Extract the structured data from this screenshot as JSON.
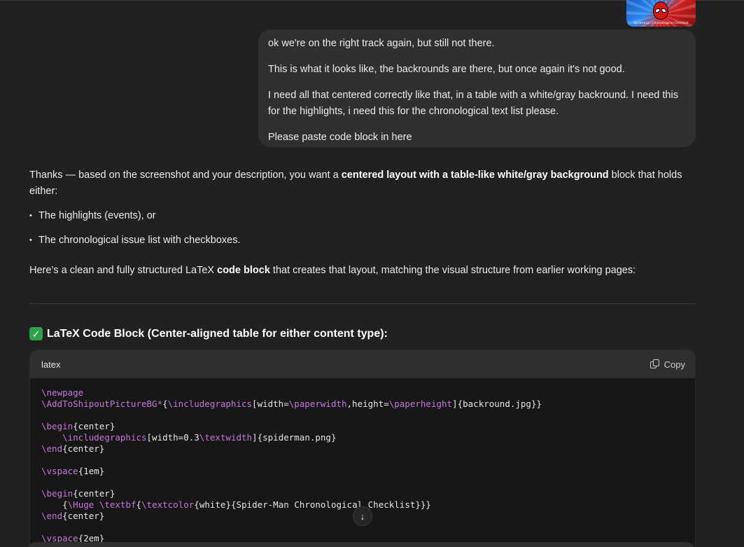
{
  "thumbnail": {
    "caption": "Spiderman Chronological Checklist"
  },
  "user_message": {
    "paragraphs": [
      "ok we're on the right track again, but still not there.",
      "This is what it looks like, the backrounds are there, but once again it's not good.",
      "I need all that centered correctly like that, in a table with a white/gray backround.  I need this for the highlights, i need this for the chronological text list please.",
      "Please paste code block in here"
    ]
  },
  "assistant": {
    "intro_before": "Thanks — based on the screenshot and your description, you want a ",
    "intro_bold": "centered layout with a table-like white/gray background",
    "intro_after": " block that holds either:",
    "bullets": [
      "The highlights (events), or",
      "The chronological issue list with checkboxes."
    ],
    "intro2_before": "Here’s a clean and fully structured LaTeX ",
    "intro2_bold": "code block",
    "intro2_after": " that creates that layout, matching the visual structure from earlier working pages:",
    "heading_icon": "✓",
    "heading": "LaTeX Code Block (Center-aligned table for either content type):"
  },
  "code_block": {
    "language": "latex",
    "copy_label": "Copy",
    "lines": [
      "\\newpage",
      "\\AddToShipoutPictureBG*{\\includegraphics[width=\\paperwidth,height=\\paperheight]{backround.jpg}}",
      "",
      "\\begin{center}",
      "    \\includegraphics[width=0.3\\textwidth]{spiderman.png}",
      "\\end{center}",
      "",
      "\\vspace{1em}",
      "",
      "\\begin{center}",
      "    {\\Huge \\textbf{\\textcolor{white}{Spider-Man Chronological Checklist}}}",
      "\\end{center}",
      "",
      "\\vspace{2em}"
    ]
  },
  "scroll_button": {
    "icon": "↓"
  },
  "colors": {
    "background": "#212121",
    "bubble": "#303030",
    "code_bg": "#171717",
    "keyword": "#c678dd",
    "check_green": "#2fa14b"
  }
}
